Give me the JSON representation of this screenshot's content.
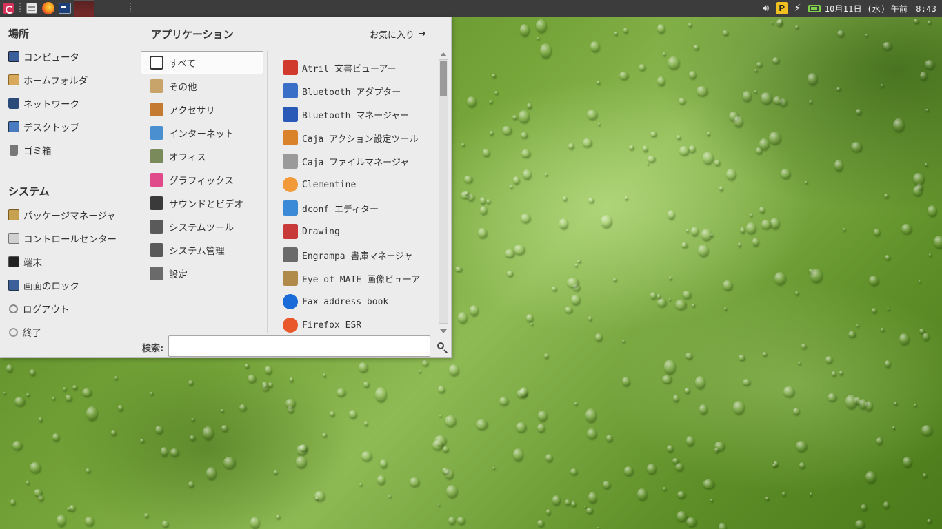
{
  "panel": {
    "clock": "10月11日 (水) 午前　8:43",
    "launchers": [
      "menu-icon",
      "file-manager-icon",
      "firefox-icon",
      "terminal-icon"
    ],
    "tray_icons": [
      "volume-icon",
      "input-method-icon",
      "network-icon",
      "battery-icon"
    ],
    "input_method_label": "P"
  },
  "places": {
    "title": "場所",
    "items": [
      {
        "label": "コンピュータ",
        "icon": "computer-icon"
      },
      {
        "label": "ホームフォルダ",
        "icon": "home-folder-icon"
      },
      {
        "label": "ネットワーク",
        "icon": "network-icon"
      },
      {
        "label": "デスクトップ",
        "icon": "desktop-icon"
      },
      {
        "label": "ゴミ箱",
        "icon": "trash-icon"
      }
    ]
  },
  "system": {
    "title": "システム",
    "items": [
      {
        "label": "パッケージマネージャ",
        "icon": "package-icon"
      },
      {
        "label": "コントロールセンター",
        "icon": "control-center-icon"
      },
      {
        "label": "端末",
        "icon": "terminal-icon"
      },
      {
        "label": "画面のロック",
        "icon": "lock-screen-icon"
      },
      {
        "label": "ログアウト",
        "icon": "logout-icon"
      },
      {
        "label": "終了",
        "icon": "shutdown-icon"
      }
    ]
  },
  "applications": {
    "title": "アプリケーション",
    "favorites_label": "お気に入り",
    "categories": [
      {
        "label": "すべて",
        "icon": "all-icon",
        "color": "#ffffff",
        "selected": true
      },
      {
        "label": "その他",
        "icon": "other-icon",
        "color": "#c8a36a"
      },
      {
        "label": "アクセサリ",
        "icon": "accessories-icon",
        "color": "#c47a30"
      },
      {
        "label": "インターネット",
        "icon": "internet-icon",
        "color": "#4a8fd0"
      },
      {
        "label": "オフィス",
        "icon": "office-icon",
        "color": "#7a8a5a"
      },
      {
        "label": "グラフィックス",
        "icon": "graphics-icon",
        "color": "#e04a8a"
      },
      {
        "label": "サウンドとビデオ",
        "icon": "sound-video-icon",
        "color": "#3a3a3a"
      },
      {
        "label": "システムツール",
        "icon": "system-tools-icon",
        "color": "#5a5a5a"
      },
      {
        "label": "システム管理",
        "icon": "administration-icon",
        "color": "#5a5a5a"
      },
      {
        "label": "設定",
        "icon": "settings-icon",
        "color": "#6a6a6a"
      }
    ],
    "apps": [
      {
        "label": "Atril 文書ビューアー",
        "icon": "atril-icon",
        "color": "#d0392b"
      },
      {
        "label": "Bluetooth アダプター",
        "icon": "bluetooth-adapter-icon",
        "color": "#3a6fc8"
      },
      {
        "label": "Bluetooth マネージャー",
        "icon": "bluetooth-manager-icon",
        "color": "#2a5ab8"
      },
      {
        "label": "Caja アクション設定ツール",
        "icon": "caja-actions-icon",
        "color": "#d9822b"
      },
      {
        "label": "Caja ファイルマネージャ",
        "icon": "caja-icon",
        "color": "#9a9a9a"
      },
      {
        "label": "Clementine",
        "icon": "clementine-icon",
        "color": "#f29a3a"
      },
      {
        "label": "dconf エディター",
        "icon": "dconf-icon",
        "color": "#3a8ad8"
      },
      {
        "label": "Drawing",
        "icon": "drawing-icon",
        "color": "#c83a3a"
      },
      {
        "label": "Engrampa 書庫マネージャ",
        "icon": "engrampa-icon",
        "color": "#6a6a6a"
      },
      {
        "label": "Eye of MATE 画像ビューア",
        "icon": "eom-icon",
        "color": "#b08a4a"
      },
      {
        "label": "Fax address book",
        "icon": "hp-icon",
        "color": "#1a6ad8"
      },
      {
        "label": "Firefox ESR",
        "icon": "firefox-icon",
        "color": "#e8582a"
      }
    ]
  },
  "search": {
    "label": "検索:",
    "value": "",
    "placeholder": ""
  }
}
